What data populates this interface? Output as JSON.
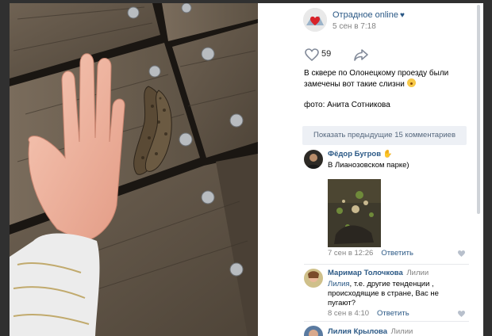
{
  "post": {
    "group_name": "Отрадное online",
    "date": "5 сен в 7:18",
    "likes": "59",
    "text_line1": "В сквере по Олонецкому проезду были замечены вот такие слизни",
    "text_credit": "фото: Анита Сотникова"
  },
  "comments": {
    "show_previous": "Показать предыдущие 15 комментариев",
    "items": [
      {
        "author": "Фёдор Бугров",
        "text": "В Лианозовском парке)",
        "date": "7 сен в 12:26",
        "reply": "Ответить"
      },
      {
        "author": "Маримар Толочкова",
        "reply_to": "Лилии",
        "reply_name": "Лилия",
        "text": ", т.е. другие тенденции , происходящие в стране, Вас не пугают?",
        "date": "8 сен в 4:10",
        "reply": "Ответить"
      },
      {
        "author": "Лилия Крылова",
        "reply_to": "Лилии"
      }
    ]
  },
  "colors": {
    "link": "#2a5885",
    "meta": "#828282",
    "show_prev_bg": "#edf0f5",
    "backdrop": "#303030"
  }
}
